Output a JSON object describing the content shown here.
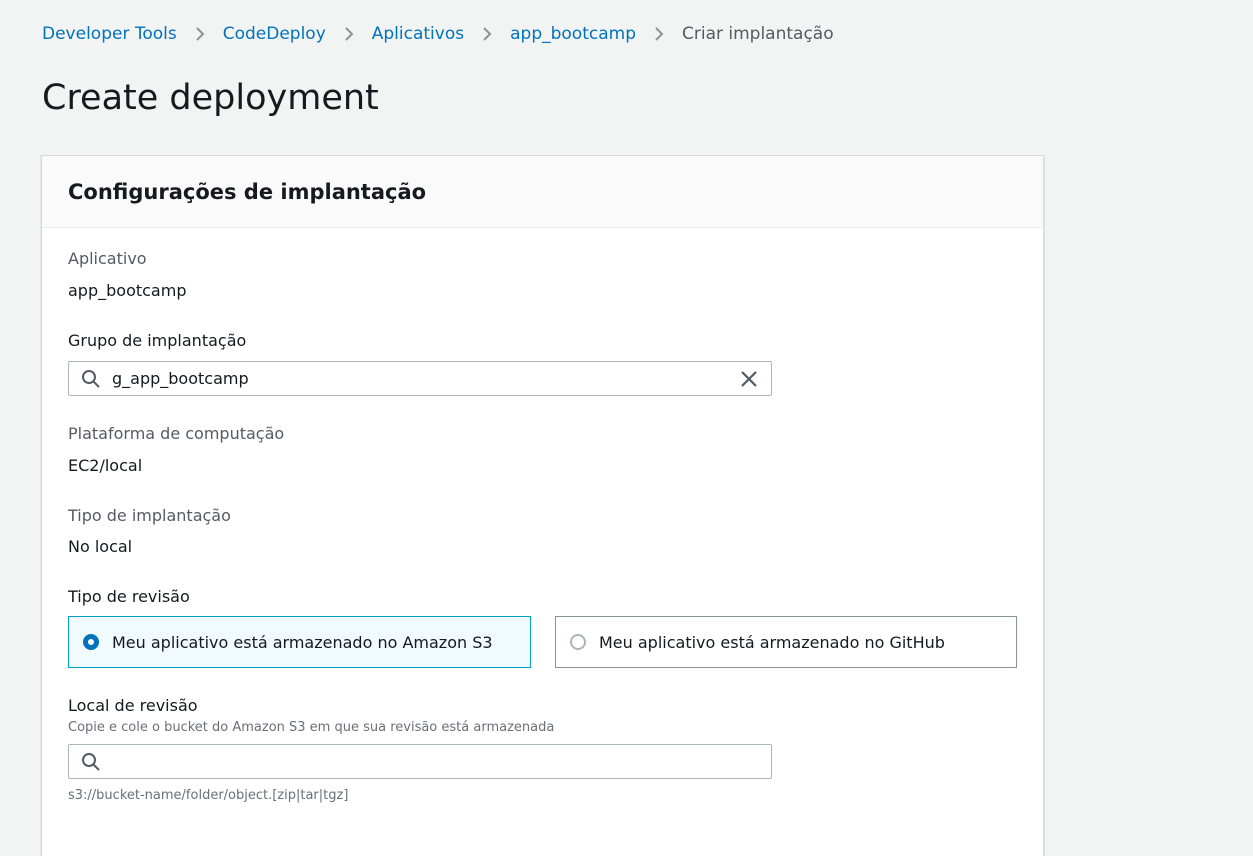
{
  "breadcrumb": {
    "items": [
      "Developer Tools",
      "CodeDeploy",
      "Aplicativos",
      "app_bootcamp"
    ],
    "current": "Criar implantação"
  },
  "page": {
    "title": "Create deployment"
  },
  "settings": {
    "title": "Configurações de implantação",
    "application": {
      "label": "Aplicativo",
      "value": "app_bootcamp"
    },
    "deployment_group": {
      "label": "Grupo de implantação",
      "value": "g_app_bootcamp"
    },
    "compute_platform": {
      "label": "Plataforma de computação",
      "value": "EC2/local"
    },
    "deployment_type": {
      "label": "Tipo de implantação",
      "value": "No local"
    },
    "revision_type": {
      "label": "Tipo de revisão",
      "options": [
        {
          "label": "Meu aplicativo está armazenado no Amazon S3",
          "selected": true
        },
        {
          "label": "Meu aplicativo está armazenado no GitHub",
          "selected": false
        }
      ]
    },
    "revision_location": {
      "label": "Local de revisão",
      "description": "Copie e cole o bucket do Amazon S3 em que sua revisão está armazenada",
      "value": "",
      "hint": "s3://bucket-name/folder/object.[zip|tar|tgz]"
    }
  },
  "icons": {
    "breadcrumb_separator": "chevron-right-icon",
    "search": "search-icon",
    "clear": "close-icon"
  },
  "colors": {
    "link": "#0073bb",
    "selected_border": "#00a1c9",
    "selected_bg": "#f1faff",
    "background": "#f2f3f3"
  }
}
